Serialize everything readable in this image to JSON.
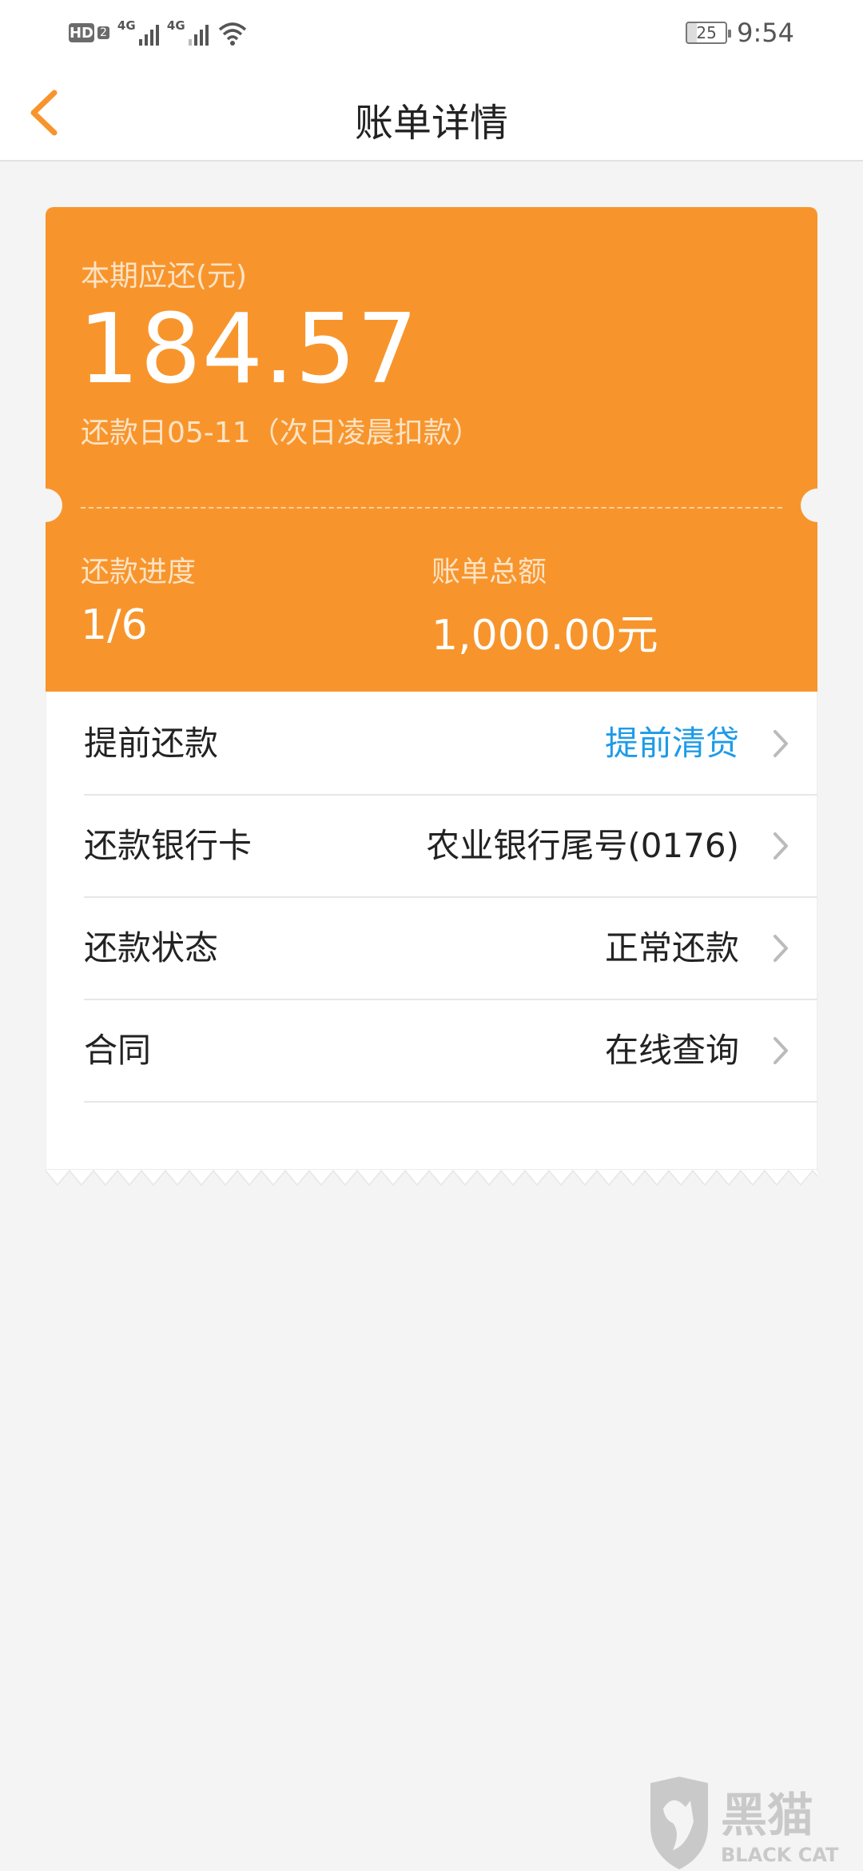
{
  "status_bar": {
    "hd_label": "HD",
    "sim_label": "2",
    "sim1_network": "4G",
    "sim2_network": "4G",
    "battery_level": "25",
    "time": "9:54"
  },
  "header": {
    "title": "账单详情",
    "back_icon": "chevron-left-icon",
    "accent_color": "#f7952c"
  },
  "summary": {
    "due_label": "本期应还(元)",
    "due_amount": "184.57",
    "due_date": "还款日05-11（次日凌晨扣款）",
    "progress_label": "还款进度",
    "progress_value": "1/6",
    "total_label": "账单总额",
    "total_value": "1,000.00元",
    "card_color": "#f7952c"
  },
  "rows": [
    {
      "label": "提前还款",
      "value": "提前清贷",
      "value_color": "#1d9be8"
    },
    {
      "label": "还款银行卡",
      "value": "农业银行尾号(0176)"
    },
    {
      "label": "还款状态",
      "value": "正常还款"
    },
    {
      "label": "合同",
      "value": "在线查询"
    }
  ],
  "watermark": {
    "title": "黑猫",
    "subtitle": "BLACK CAT"
  }
}
